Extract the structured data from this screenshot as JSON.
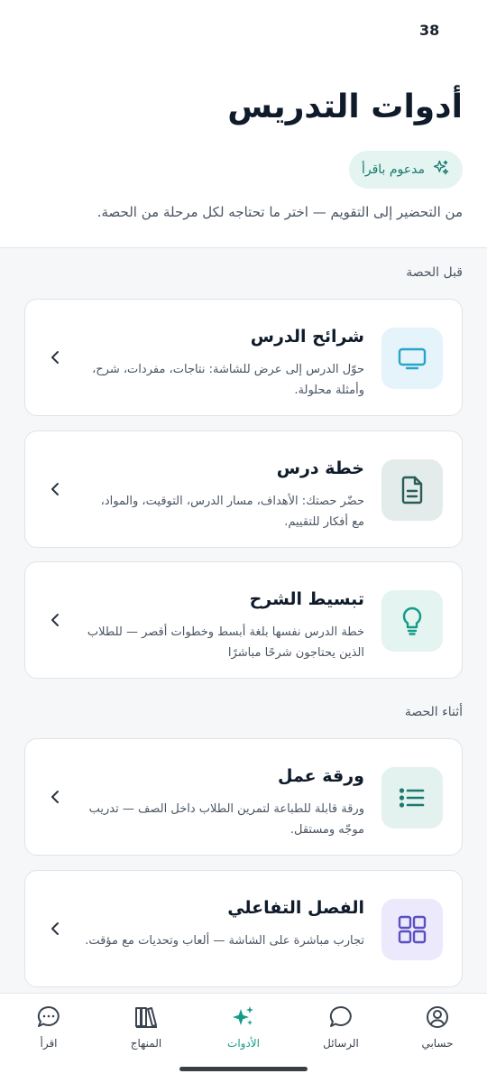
{
  "status": {
    "time": "38"
  },
  "header": {
    "title": "أدوات التدريس",
    "badge": "مدعوم باقرأ",
    "subtitle": "من التحضير إلى التقويم — اختر ما تحتاجه لكل مرحلة من الحصة."
  },
  "sections": [
    {
      "label": "قبل الحصة",
      "cards": [
        {
          "title": "شرائح الدرس",
          "desc": "حوّل الدرس إلى عرض للشاشة: نتاجات، مفردات، شرح، وأمثلة محلولة.",
          "icon": "monitor-icon",
          "color": "#2aa3c8",
          "bg": "#e4f4fa"
        },
        {
          "title": "خطة درس",
          "desc": "حضّر حصتك: الأهداف، مسار الدرس، التوقيت، والمواد، مع أفكار للتقييم.",
          "icon": "document-icon",
          "color": "#2a5d57",
          "bg": "#e3ecea"
        },
        {
          "title": "تبسيط الشرح",
          "desc": "خطة الدرس نفسها بلغة أبسط وخطوات أقصر — للطلاب الذين يحتاجون شرحًا مباشرًا",
          "icon": "lightbulb-icon",
          "color": "#149c89",
          "bg": "#e3f4f1"
        }
      ]
    },
    {
      "label": "أثناء الحصة",
      "cards": [
        {
          "title": "ورقة عمل",
          "desc": "ورقة قابلة للطباعة لتمرين الطلاب داخل الصف — تدريب موجّه ومستقل.",
          "icon": "list-icon",
          "color": "#1a7a6e",
          "bg": "#e3f1ef"
        },
        {
          "title": "الفصل التفاعلي",
          "desc": "تجارب مباشرة على الشاشة — ألعاب وتحديات مع مؤقت.",
          "icon": "grid-icon",
          "color": "#5b4fc4",
          "bg": "#ebe9fb"
        }
      ]
    }
  ],
  "nav": {
    "items": [
      {
        "label": "حسابي",
        "icon": "account-icon"
      },
      {
        "label": "الرسائل",
        "icon": "chat-icon"
      },
      {
        "label": "الأدوات",
        "icon": "sparkles-icon",
        "active": true
      },
      {
        "label": "المنهاج",
        "icon": "books-icon"
      },
      {
        "label": "اقرأ",
        "icon": "chat-dots-icon"
      }
    ]
  },
  "colors": {
    "accent": "#149c89",
    "title": "#0f1b2a",
    "badge_bg": "#e3f4f1"
  }
}
